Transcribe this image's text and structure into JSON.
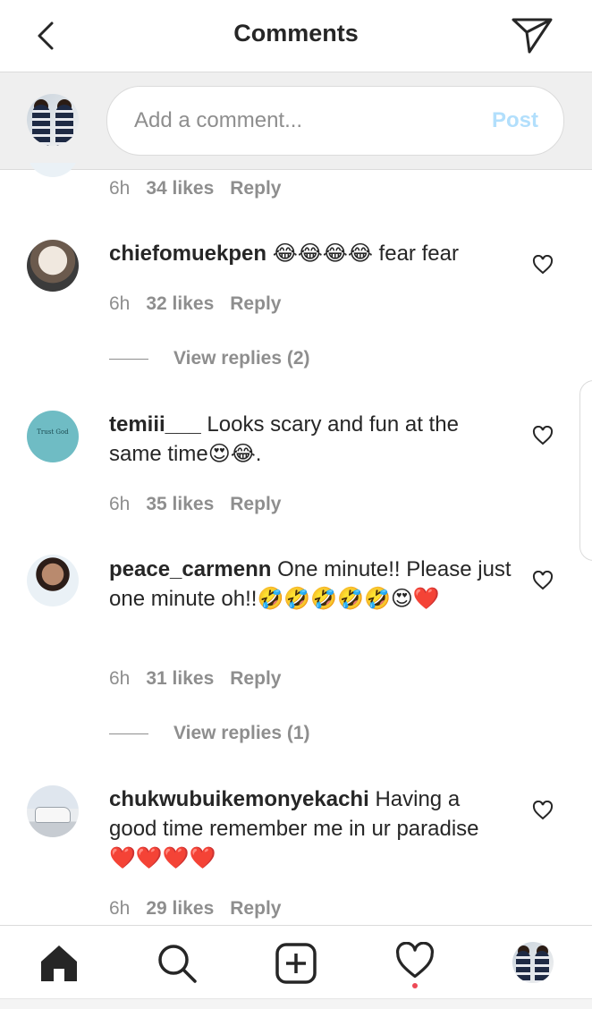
{
  "header": {
    "title": "Comments"
  },
  "composer": {
    "placeholder": "Add a comment...",
    "post_label": "Post"
  },
  "partial_comment": {
    "time": "6h",
    "likes": "34 likes",
    "reply": "Reply"
  },
  "comments": [
    {
      "username": "chiefomuekpen",
      "text": "😂😂😂😂 fear fear",
      "time": "6h",
      "likes": "32 likes",
      "reply": "Reply",
      "view_replies": "View replies (2)"
    },
    {
      "username": "temiii___",
      "text": "Looks scary and fun at the same time😍😂.",
      "time": "6h",
      "likes": "35 likes",
      "reply": "Reply",
      "avatar_text": "Trust God"
    },
    {
      "username": "peace_carmenn",
      "text": "One minute!! Please just one minute oh!!🤣🤣🤣🤣🤣😍❤️",
      "time": "6h",
      "likes": "31 likes",
      "reply": "Reply",
      "view_replies": "View replies (1)"
    },
    {
      "username": "chukwubuikemonyekachi",
      "text": "Having a good time remember me in ur paradise ❤️❤️❤️❤️",
      "time": "6h",
      "likes": "29 likes",
      "reply": "Reply"
    }
  ],
  "nav": {
    "items": [
      "home-icon",
      "search-icon",
      "new-post-icon",
      "activity-heart-icon",
      "profile-avatar"
    ],
    "notification_color": "#ed4956"
  },
  "colors": {
    "post_disabled": "#b2dffc",
    "meta_gray": "#8e8e8e",
    "text": "#262626"
  }
}
